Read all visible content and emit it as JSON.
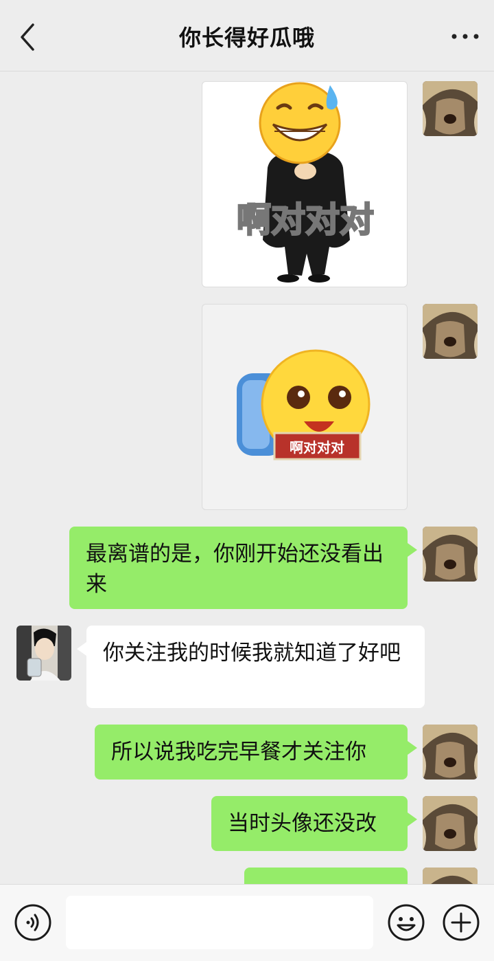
{
  "header": {
    "title": "你长得好瓜哦",
    "back_icon": "chevron-left-icon",
    "more_icon": "more-dots-icon"
  },
  "messages": [
    {
      "side": "right",
      "type": "sticker",
      "caption": "啊对对对"
    },
    {
      "side": "right",
      "type": "sticker",
      "caption": "啊对对对"
    },
    {
      "side": "right",
      "type": "text",
      "text": "最离谱的是，你刚开始还没看出来"
    },
    {
      "side": "left",
      "type": "text",
      "text": "你关注我的时候我就知道了好吧"
    },
    {
      "side": "right",
      "type": "text",
      "text": "所以说我吃完早餐才关注你"
    },
    {
      "side": "right",
      "type": "text",
      "text": "当时头像还没改"
    }
  ],
  "input_bar": {
    "voice_icon": "voice-icon",
    "message_value": "",
    "emoji_icon": "emoji-icon",
    "plus_icon": "plus-icon"
  },
  "colors": {
    "background": "#ededed",
    "sent_bubble": "#95ec69",
    "received_bubble": "#ffffff"
  }
}
